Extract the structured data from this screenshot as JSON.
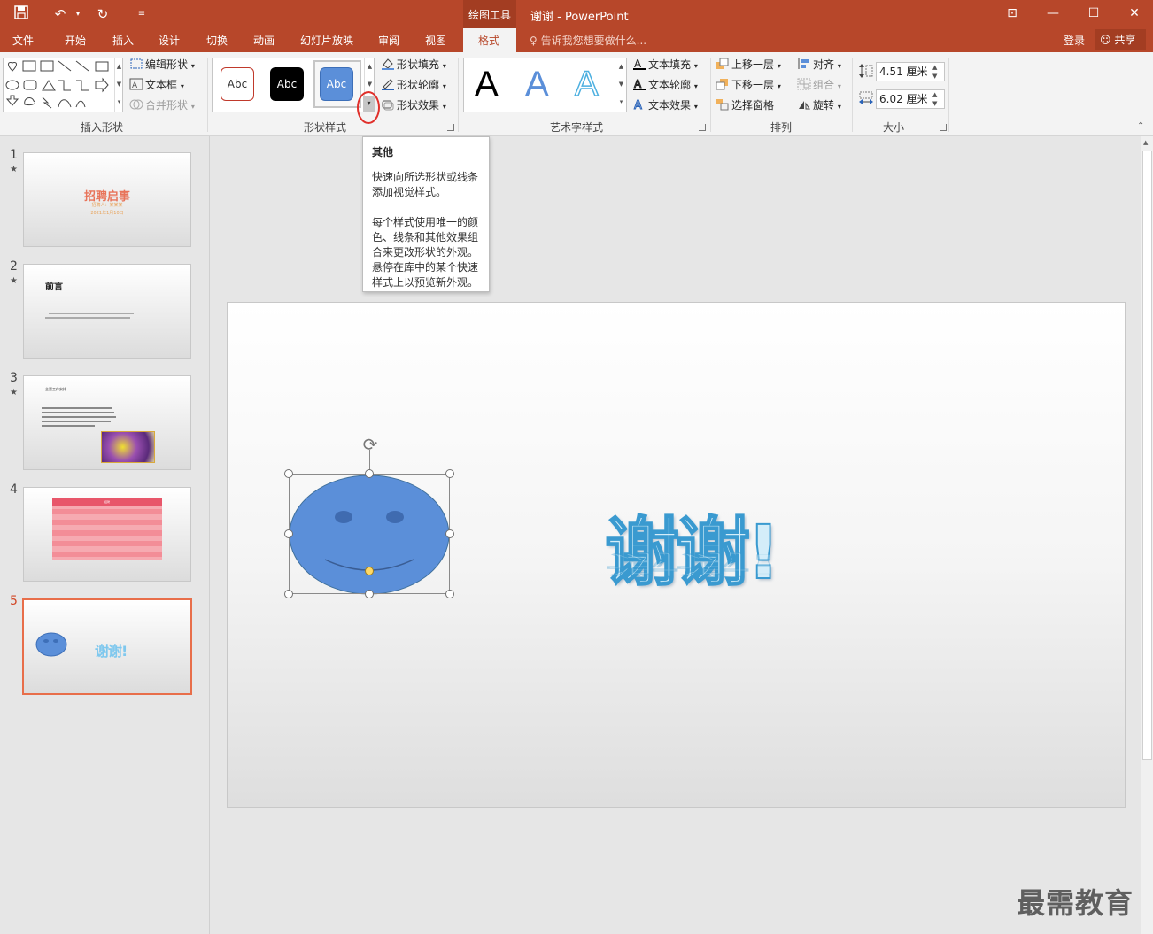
{
  "titlebar": {
    "context_tool": "绘图工具",
    "doc_title": "谢谢 - PowerPoint"
  },
  "tabs": [
    {
      "label": "文件"
    },
    {
      "label": "开始"
    },
    {
      "label": "插入"
    },
    {
      "label": "设计"
    },
    {
      "label": "切换"
    },
    {
      "label": "动画"
    },
    {
      "label": "幻灯片放映"
    },
    {
      "label": "审阅"
    },
    {
      "label": "视图"
    },
    {
      "label": "格式"
    }
  ],
  "tell_me": "告诉我您想要做什么...",
  "login": "登录",
  "share": "共享",
  "ribbon": {
    "insert_shapes": {
      "label": "插入形状",
      "edit_shape": "编辑形状",
      "text_box": "文本框",
      "merge_shapes": "合并形状"
    },
    "shape_styles": {
      "label": "形状样式",
      "swatches": [
        "Abc",
        "Abc",
        "Abc"
      ],
      "fill": "形状填充",
      "outline": "形状轮廓",
      "effects": "形状效果"
    },
    "wordart": {
      "label": "艺术字样式",
      "letters": [
        "A",
        "A",
        "A"
      ],
      "text_fill": "文本填充",
      "text_outline": "文本轮廓",
      "text_effects": "文本效果"
    },
    "arrange": {
      "label": "排列",
      "bring_forward": "上移一层",
      "send_backward": "下移一层",
      "selection_pane": "选择窗格",
      "align": "对齐",
      "group": "组合",
      "rotate": "旋转"
    },
    "size": {
      "label": "大小",
      "height": "4.51 厘米",
      "width": "6.02 厘米"
    }
  },
  "tooltip": {
    "title": "其他",
    "p1": "快速向所选形状或线条添加视觉样式。",
    "p2": "每个样式使用唯一的颜色、线条和其他效果组合来更改形状的外观。悬停在库中的某个快速样式上以预览新外观。"
  },
  "thumbnails": [
    {
      "num": "1",
      "star": "★",
      "title": "招聘启事",
      "sub1": "招聘人：某某某",
      "sub2": "2021年1月10日"
    },
    {
      "num": "2",
      "star": "★",
      "title": "前言"
    },
    {
      "num": "3",
      "star": "★",
      "title": "主要工作安排"
    },
    {
      "num": "4",
      "title": "招聘"
    },
    {
      "num": "5",
      "text": "谢谢!"
    }
  ],
  "slide": {
    "thanks_text": "谢谢!"
  },
  "watermark": "最需教育",
  "colors": {
    "accent": "#b7472a",
    "smiley": "#5b8fd9",
    "wordart": "#4db0e0",
    "selected_border": "#e86e4a"
  }
}
